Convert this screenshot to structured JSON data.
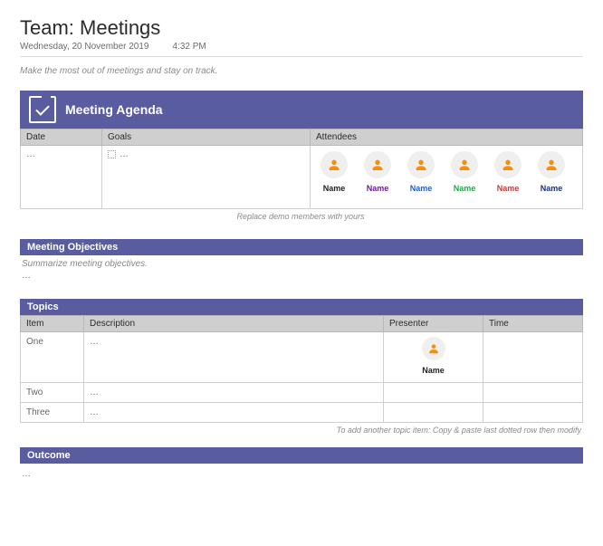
{
  "header": {
    "title": "Team: Meetings",
    "date": "Wednesday, 20 November 2019",
    "time": "4:32 PM",
    "tagline": "Make the most out of meetings and stay on track."
  },
  "agenda": {
    "title": "Meeting Agenda",
    "columns": {
      "date": "Date",
      "goals": "Goals",
      "attendees": "Attendees"
    },
    "row": {
      "date": "…",
      "goals": "…"
    },
    "attendees": [
      {
        "name": "Name"
      },
      {
        "name": "Name"
      },
      {
        "name": "Name"
      },
      {
        "name": "Name"
      },
      {
        "name": "Name"
      },
      {
        "name": "Name"
      }
    ],
    "hint": "Replace demo members with yours"
  },
  "objectives": {
    "title": "Meeting Objectives",
    "placeholder": "Summarize meeting objectives.",
    "content": "…"
  },
  "topics": {
    "title": "Topics",
    "columns": {
      "item": "Item",
      "description": "Description",
      "presenter": "Presenter",
      "time": "Time"
    },
    "rows": [
      {
        "item": "One",
        "description": "…",
        "presenter": "Name",
        "time": ""
      },
      {
        "item": "Two",
        "description": "…",
        "presenter": "",
        "time": ""
      },
      {
        "item": "Three",
        "description": "…",
        "presenter": "",
        "time": ""
      }
    ],
    "hint": "To add another topic item: Copy & paste last dotted row then modify"
  },
  "outcome": {
    "title": "Outcome",
    "content": "…"
  }
}
